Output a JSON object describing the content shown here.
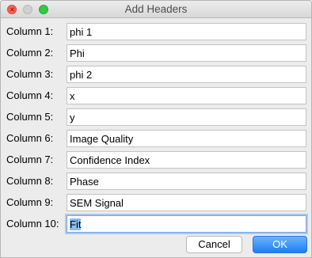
{
  "window": {
    "title": "Add Headers"
  },
  "columns": [
    {
      "label": "Column 1:",
      "value": "phi 1"
    },
    {
      "label": "Column 2:",
      "value": "Phi"
    },
    {
      "label": "Column 3:",
      "value": "phi 2"
    },
    {
      "label": "Column 4:",
      "value": "x"
    },
    {
      "label": "Column 5:",
      "value": "y"
    },
    {
      "label": "Column 6:",
      "value": "Image Quality"
    },
    {
      "label": "Column 7:",
      "value": "Confidence Index"
    },
    {
      "label": "Column 8:",
      "value": "Phase"
    },
    {
      "label": "Column 9:",
      "value": "SEM Signal"
    },
    {
      "label": "Column 10:",
      "value": "Fit"
    }
  ],
  "buttons": {
    "cancel": "Cancel",
    "ok": "OK"
  }
}
